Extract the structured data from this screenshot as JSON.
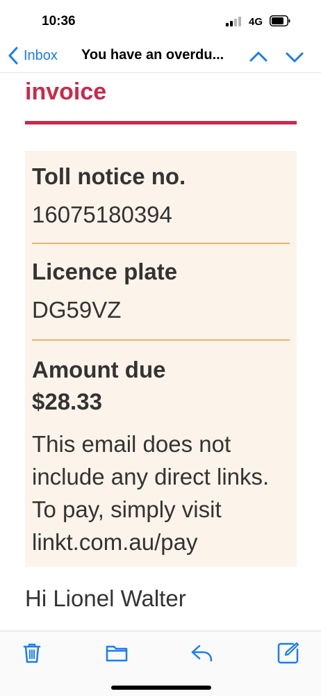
{
  "status_bar": {
    "time": "10:36",
    "network": "4G",
    "icons": [
      "signal-icon",
      "battery-icon"
    ]
  },
  "nav": {
    "back_label": "Inbox",
    "subject": "You have an overdu...",
    "icons": [
      "chevron-left-icon",
      "chevron-up-icon",
      "chevron-down-icon"
    ]
  },
  "email": {
    "heading": "invoice",
    "fields": [
      {
        "label": "Toll notice no.",
        "value": "16075180394"
      },
      {
        "label": "Licence plate",
        "value": "DG59VZ"
      },
      {
        "label": "Amount due",
        "value": "$28.33"
      }
    ],
    "note": "This email does not include any direct links. To pay, simply visit linkt.com.au/pay",
    "greeting": "Hi Lionel Walter"
  },
  "toolbar": {
    "icons": [
      "trash-icon",
      "folder-icon",
      "reply-icon",
      "compose-icon"
    ]
  },
  "colors": {
    "accent": "#1a7cf5",
    "brand_red": "#cc2849",
    "panel_bg": "#fcf3ea",
    "divider": "#e9b36a",
    "text": "#333333"
  }
}
